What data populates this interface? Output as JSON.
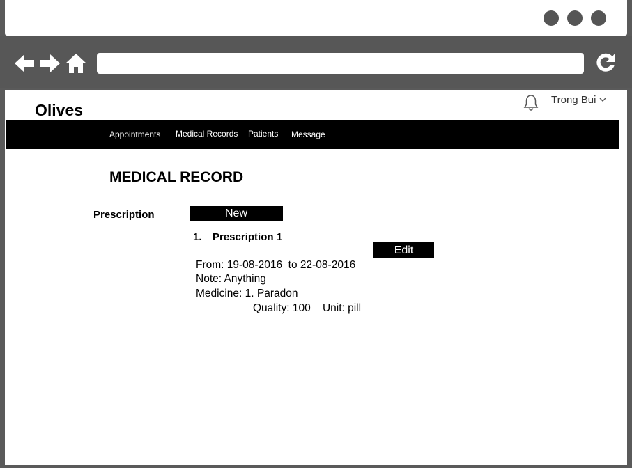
{
  "browser": {
    "address": ""
  },
  "app": {
    "brand": "Olives",
    "user_name": "Trong Bui"
  },
  "nav": {
    "items": [
      {
        "label": "Appointments"
      },
      {
        "label": "Medical Records"
      },
      {
        "label": "Patients"
      },
      {
        "label": "Message"
      }
    ]
  },
  "page": {
    "title": "MEDICAL RECORD",
    "section_label": "Prescription",
    "new_button": "New"
  },
  "prescription": {
    "number": "1.",
    "title": "Prescription 1",
    "edit_button": "Edit",
    "from_line": "From: 19-08-2016  to 22-08-2016",
    "note_line": "Note: Anything",
    "medicine_line": "Medicine: 1. Paradon",
    "quality_line": "Quality: 100    Unit: pill"
  },
  "colors": {
    "chrome": "#575757",
    "navbar": "#000000",
    "button": "#000000",
    "button_text": "#ffffff"
  },
  "icons": [
    "back-arrow-icon",
    "forward-arrow-icon",
    "home-icon",
    "reload-icon",
    "bell-icon",
    "chevron-down-icon"
  ]
}
